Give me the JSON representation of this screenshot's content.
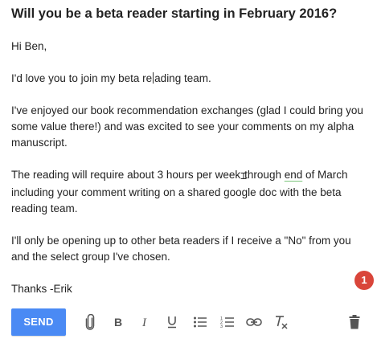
{
  "email": {
    "subject": "Will you be a beta reader starting in February 2016?",
    "greeting": "Hi Ben,",
    "p1_before_cursor": "I'd love you to join my beta re",
    "p1_after_cursor": "ading team.",
    "p2": "I've enjoyed our book recommendation exchanges (glad I could bring you some value there!) and was excited to see your comments on my alpha manuscript.",
    "p3_part1": "The reading will require about 3 hours per week",
    "p3_part2": "through ",
    "p3_underlined": "end",
    "p3_part3": " of March including your comment writing on a shared google doc with the beta reading team.",
    "p4": "I'll only be opening up to other beta readers if I receive a \"No\" from you and the select group I've chosen.",
    "signoff": "Thanks -Erik"
  },
  "notification_badge": {
    "count": "1",
    "color": "#d9453a"
  },
  "toolbar": {
    "send_label": "SEND",
    "send_color": "#4a8af4",
    "tools": [
      {
        "icon": "paperclip-icon",
        "label": "Attach files"
      },
      {
        "icon": "bold-icon",
        "label": "Bold"
      },
      {
        "icon": "italic-icon",
        "label": "Italic"
      },
      {
        "icon": "underline-icon",
        "label": "Underline"
      },
      {
        "icon": "bulleted-list-icon",
        "label": "Bulleted list"
      },
      {
        "icon": "numbered-list-icon",
        "label": "Numbered list"
      },
      {
        "icon": "link-icon",
        "label": "Insert link"
      },
      {
        "icon": "clear-formatting-icon",
        "label": "Remove formatting"
      },
      {
        "icon": "trash-icon",
        "label": "Discard draft"
      }
    ]
  }
}
